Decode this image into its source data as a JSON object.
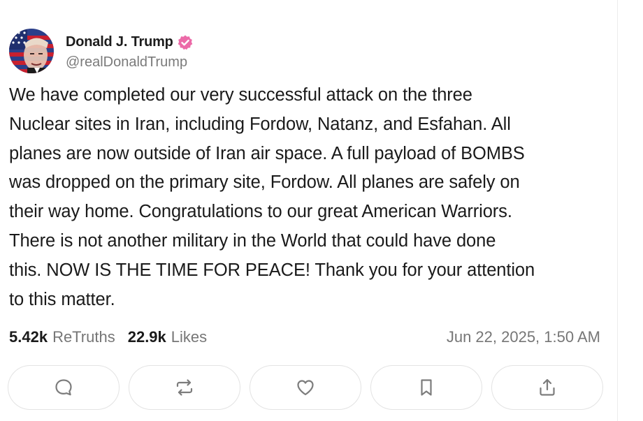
{
  "author": {
    "display_name": "Donald J. Trump",
    "handle": "@realDonaldTrump",
    "verified": true,
    "verified_icon": "verified-badge-icon",
    "accent_color": "#ec6aa8"
  },
  "post": {
    "text": "We have completed our very successful attack on the three\nNuclear sites in Iran, including Fordow, Natanz, and Esfahan. All\nplanes are now outside of Iran air space. A full payload of BOMBS\nwas dropped on the primary site, Fordow. All planes are safely on\ntheir way home. Congratulations to our great American Warriors.\nThere is not another military in the World that could have done\nthis. NOW IS THE TIME FOR PEACE! Thank you for your attention\nto this matter.",
    "timestamp": "Jun 22, 2025, 1:50 AM"
  },
  "stats": {
    "retruths_count": "5.42k",
    "retruths_label": "ReTruths",
    "likes_count": "22.9k",
    "likes_label": "Likes"
  },
  "actions": [
    {
      "icon": "reply-icon"
    },
    {
      "icon": "retruth-icon"
    },
    {
      "icon": "like-icon"
    },
    {
      "icon": "bookmark-icon"
    },
    {
      "icon": "share-icon"
    }
  ]
}
